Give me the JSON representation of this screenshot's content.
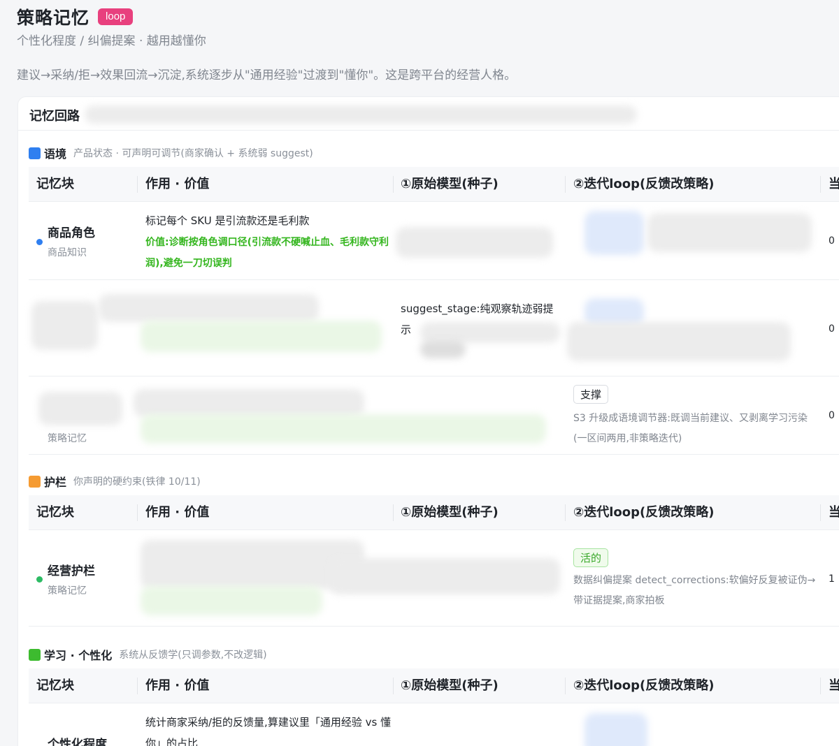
{
  "header": {
    "title": "策略记忆",
    "tag": "loop",
    "subtitle": "个性化程度 / 纠偏提案 · 越用越懂你",
    "description": "建议→采纳/拒→效果回流→沉淀,系统逐步从\"通用经验\"过渡到\"懂你\"。这是跨平台的经营人格。"
  },
  "card": {
    "title": "记忆回路"
  },
  "columns": {
    "block": "记忆块",
    "role": "作用 · 价值",
    "seed": "①原始模型(种子)",
    "iter": "②迭代loop(反馈改策略)",
    "current": "当"
  },
  "sections": [
    {
      "title": "语境",
      "subtitle": "产品状态 · 可声明可调节(商家确认 + 系统弱 suggest)",
      "color": "#2f7ff0",
      "rows": [
        {
          "name": "商品角色",
          "category": "商品知识",
          "dot_color": "#2f7ff0",
          "role": "标记每个 SKU 是引流款还是毛利款",
          "value": "价值:诊断按角色调口径(引流款不硬喊止血、毛利款守利润),避免一刀切误判",
          "current": "0"
        },
        {
          "seed": "suggest_stage:纯观察轨迹弱提示",
          "current": "0"
        },
        {
          "category": "策略记忆",
          "badge": "支撑",
          "iter_desc": "S3 升级成语境调节器:既调当前建议、又剥离学习污染(一区间两用,非策略迭代)",
          "current": "0"
        }
      ]
    },
    {
      "title": "护栏",
      "subtitle": "你声明的硬约束(铁律 10/11)",
      "color": "#f59b32",
      "rows": [
        {
          "name": "经营护栏",
          "category": "策略记忆",
          "dot_color": "#2dbb64",
          "badge": "活的",
          "iter_desc": "数据纠偏提案 detect_corrections:软偏好反复被证伪→带证据提案,商家拍板",
          "current": "1"
        }
      ]
    },
    {
      "title": "学习 · 个性化",
      "subtitle": "系统从反馈学(只调参数,不改逻辑)",
      "color": "#3dbb2f",
      "rows": [
        {
          "name": "个性化程度",
          "role": "统计商家采纳/拒的反馈量,算建议里「通用经验 vs 懂你」的占比"
        }
      ]
    }
  ]
}
